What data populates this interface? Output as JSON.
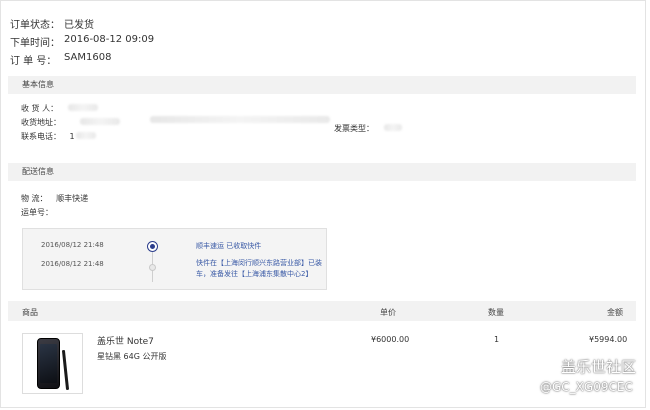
{
  "order": {
    "status_label": "订单状态：",
    "status_value": "已发货",
    "time_label": "下单时间：",
    "time_value": "2016-08-12 09:09",
    "id_label": "订 单 号：",
    "id_value": "SAM1608"
  },
  "basic_info": {
    "title": "基本信息",
    "receiver_label": "收 货 人：",
    "address_label": "收货地址：",
    "phone_label": "联系电话：",
    "phone_value": "1",
    "invoice_label": "发票类型："
  },
  "delivery": {
    "title": "配送信息",
    "logistics_label": "物    流：",
    "logistics_value": "顺丰快递",
    "waybill_label": "运单号：",
    "tracking": [
      {
        "time": "2016/08/12 21:48",
        "desc": "顺丰速运 已收取快件"
      },
      {
        "time": "2016/08/12 21:48",
        "desc": "快件在【上海闵行顺兴东路营业部】已装车，准备发往【上海浦东集散中心2】"
      }
    ]
  },
  "products": {
    "headers": {
      "name": "商品",
      "price": "单价",
      "qty": "数量",
      "amount": "金额"
    },
    "items": [
      {
        "name": "盖乐世 Note7",
        "spec": "星钻黑  64G  公开版",
        "price": "¥6000.00",
        "qty": "1",
        "amount": "¥5994.00",
        "image": "phone-image"
      }
    ]
  },
  "watermark": {
    "line1": "盖乐世社区",
    "line2": "@GC_XG09CEC"
  },
  "colors": {
    "section_bg": "#f2f2f2",
    "link_blue": "#3a5aa6",
    "accent_dark": "#2c3e8c"
  }
}
